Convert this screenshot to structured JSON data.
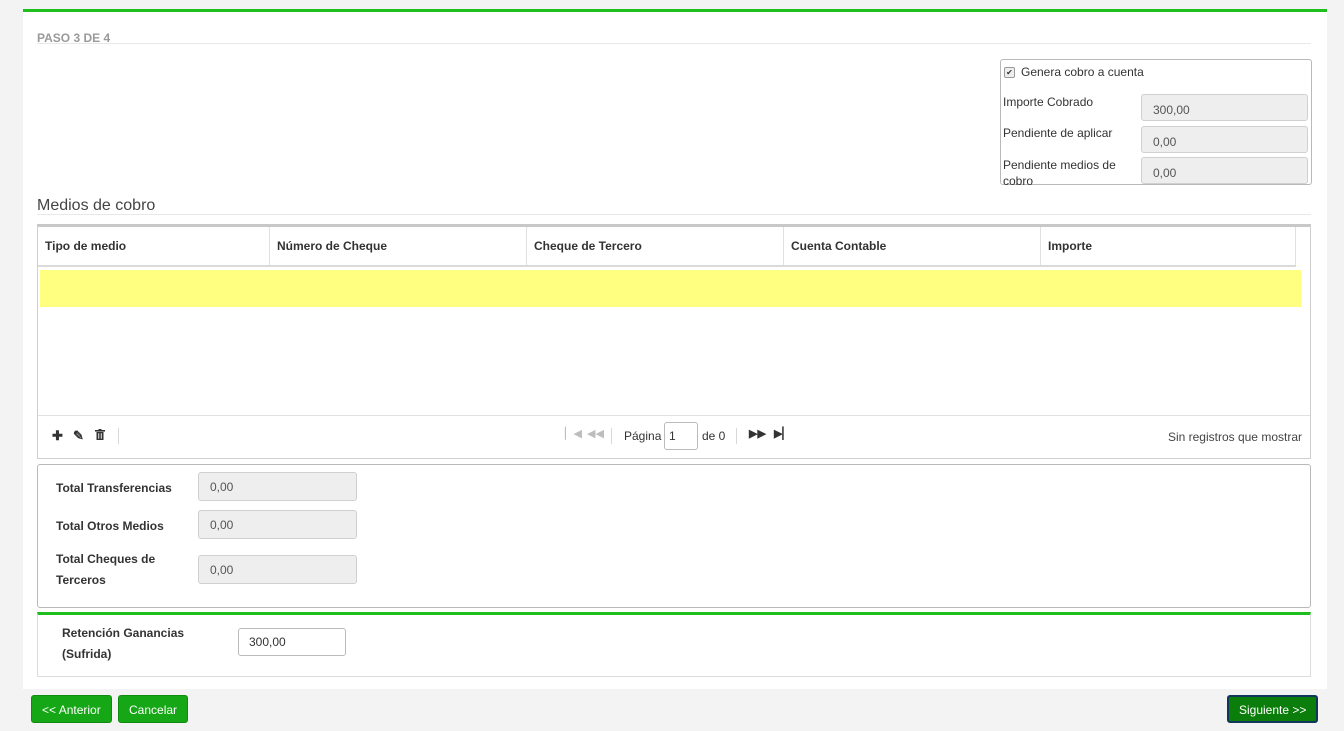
{
  "wizard": {
    "step_label": "PASO 3 DE 4"
  },
  "summary": {
    "generates_label": "Genera cobro a cuenta",
    "generates_checked": true,
    "importe_cobrado_label": "Importe Cobrado",
    "importe_cobrado_value": "300,00",
    "pendiente_aplicar_label": "Pendiente de aplicar",
    "pendiente_aplicar_value": "0,00",
    "pendiente_medios_label": "Pendiente medios de cobro",
    "pendiente_medios_value": "0,00"
  },
  "medios": {
    "title": "Medios de cobro",
    "columns": [
      "Tipo de medio",
      "Número de Cheque",
      "Cheque de Tercero",
      "Cuenta Contable",
      "Importe"
    ],
    "toolbar": {
      "add_icon": "plus-icon",
      "edit_icon": "pencil-icon",
      "delete_icon": "trash-icon"
    },
    "pager": {
      "page_label": "Página",
      "page_value": "1",
      "of_label": "de 0",
      "empty_text": "Sin registros que mostrar"
    }
  },
  "totals": {
    "transferencias_label": "Total Transferencias",
    "transferencias_value": "0,00",
    "otros_label": "Total Otros Medios",
    "otros_value": "0,00",
    "cheques_label": "Total Cheques de Terceros",
    "cheques_value": "0,00"
  },
  "retencion": {
    "label": "Retención Ganancias (Sufrida)",
    "value": "300,00"
  },
  "buttons": {
    "anterior": "<< Anterior",
    "cancelar": "Cancelar",
    "siguiente": "Siguiente >>"
  },
  "colors": {
    "accent": "#1fbe1f",
    "button": "#16a716",
    "highlight_row": "#ffff80"
  }
}
